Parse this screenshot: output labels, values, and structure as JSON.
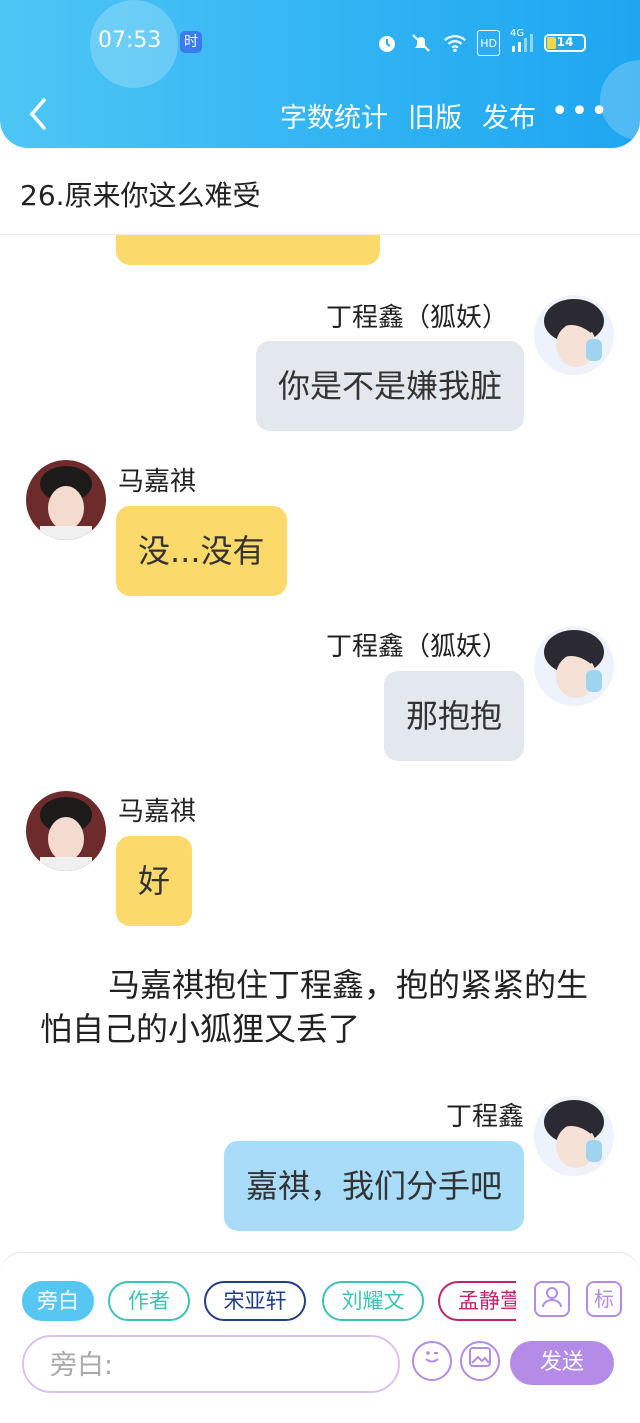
{
  "status_bar": {
    "time": "07:53",
    "time_badge": "时",
    "hd": "HD",
    "network": "4G",
    "battery": "14"
  },
  "navbar": {
    "word_count": "字数统计",
    "old_version": "旧版",
    "publish": "发布",
    "more": "•••"
  },
  "chapter_title": "26.原来你这么难受",
  "messages": [
    {
      "speaker": "丁程鑫（狐妖）",
      "text": "你是不是嫌我脏"
    },
    {
      "speaker": "马嘉祺",
      "text": "没...没有"
    },
    {
      "speaker": "丁程鑫（狐妖）",
      "text": "那抱抱"
    },
    {
      "speaker": "马嘉祺",
      "text": "好"
    },
    {
      "narration": "马嘉祺抱住丁程鑫，抱的紧紧的生怕自己的小狐狸又丢了"
    },
    {
      "speaker": "丁程鑫",
      "text": "嘉祺，我们分手吧"
    }
  ],
  "role_chips": [
    "旁白",
    "作者",
    "宋亚轩",
    "刘耀文",
    "孟静萱"
  ],
  "role_icons": {
    "tag": "标"
  },
  "input": {
    "placeholder": "旁白:"
  },
  "send_label": "发送",
  "colors": {
    "header": "#2fb2f3",
    "bubble_yellow": "#fbd96a",
    "bubble_grey": "#e3e7ee",
    "bubble_blue": "#a8dcf9",
    "accent_purple": "#b48be6"
  }
}
